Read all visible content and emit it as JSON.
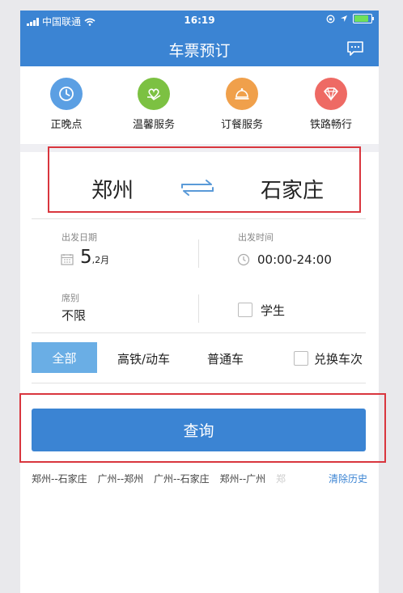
{
  "status": {
    "carrier": "中国联通",
    "time": "16:19"
  },
  "nav": {
    "title": "车票预订",
    "message_icon": "message-icon"
  },
  "services": [
    {
      "label": "正晚点",
      "icon": "clock-icon",
      "color": "#5b9fe3"
    },
    {
      "label": "温馨服务",
      "icon": "heart-hand-icon",
      "color": "#7cc142"
    },
    {
      "label": "订餐服务",
      "icon": "meal-bell-icon",
      "color": "#f0a04b"
    },
    {
      "label": "铁路畅行",
      "icon": "diamond-icon",
      "color": "#ee6a64"
    }
  ],
  "route": {
    "from": "郑州",
    "to": "石家庄"
  },
  "date": {
    "label": "出发日期",
    "day": "5",
    "month_suffix": ",2月"
  },
  "time": {
    "label": "出发时间",
    "value": "00:00-24:00"
  },
  "seat": {
    "label": "席别",
    "value": "不限"
  },
  "student": {
    "label": "学生"
  },
  "train_types": {
    "all": "全部",
    "highspeed": "高铁/动车",
    "normal": "普通车",
    "exchange": "兑换车次"
  },
  "query_button": "查询",
  "history": [
    "郑州--石家庄",
    "广州--郑州",
    "广州--石家庄",
    "郑州--广州",
    "郑"
  ],
  "clear_history": "清除历史"
}
